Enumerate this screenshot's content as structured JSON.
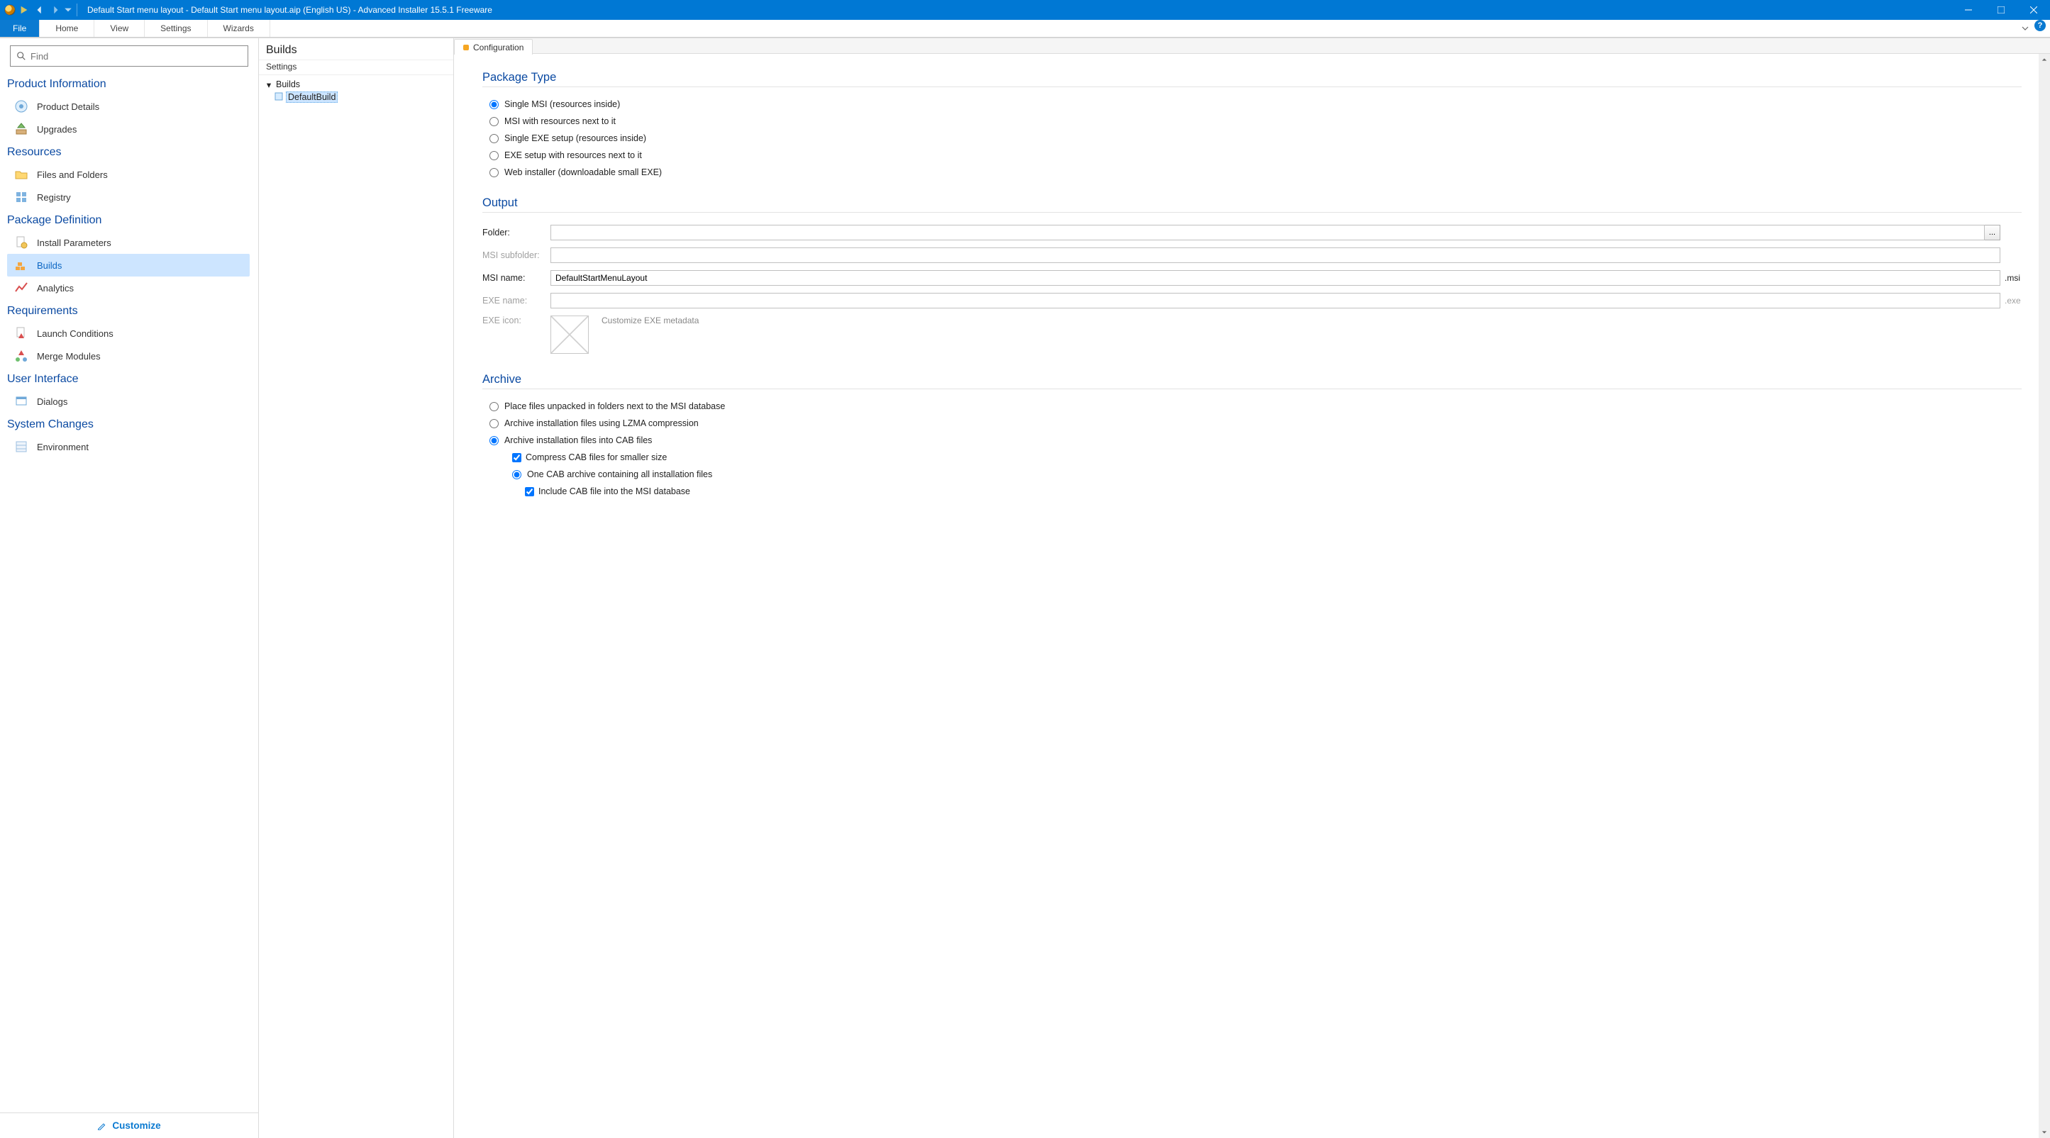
{
  "titlebar": {
    "text": "Default Start menu layout - Default Start menu layout.aip (English US) - Advanced Installer 15.5.1 Freeware"
  },
  "ribbon": {
    "file": "File",
    "tabs": [
      "Home",
      "View",
      "Settings",
      "Wizards"
    ]
  },
  "find": {
    "placeholder": "Find"
  },
  "nav": {
    "groups": [
      {
        "title": "Product Information",
        "items": [
          {
            "id": "product-details",
            "label": "Product Details"
          },
          {
            "id": "upgrades",
            "label": "Upgrades"
          }
        ]
      },
      {
        "title": "Resources",
        "items": [
          {
            "id": "files-and-folders",
            "label": "Files and Folders"
          },
          {
            "id": "registry",
            "label": "Registry"
          }
        ]
      },
      {
        "title": "Package Definition",
        "items": [
          {
            "id": "install-parameters",
            "label": "Install Parameters"
          },
          {
            "id": "builds",
            "label": "Builds",
            "active": true
          },
          {
            "id": "analytics",
            "label": "Analytics"
          }
        ]
      },
      {
        "title": "Requirements",
        "items": [
          {
            "id": "launch-conditions",
            "label": "Launch Conditions"
          },
          {
            "id": "merge-modules",
            "label": "Merge Modules"
          }
        ]
      },
      {
        "title": "User Interface",
        "items": [
          {
            "id": "dialogs",
            "label": "Dialogs"
          }
        ]
      },
      {
        "title": "System Changes",
        "items": [
          {
            "id": "environment",
            "label": "Environment"
          }
        ]
      }
    ],
    "customize": "Customize"
  },
  "tree": {
    "title": "Builds",
    "settings": "Settings",
    "root": "Builds",
    "item": "DefaultBuild"
  },
  "tabs": {
    "configuration": "Configuration"
  },
  "package_type": {
    "title": "Package Type",
    "options": [
      "Single MSI (resources inside)",
      "MSI with resources next to it",
      "Single EXE setup (resources inside)",
      "EXE setup with resources next to it",
      "Web installer (downloadable small EXE)"
    ],
    "selected": 0
  },
  "output": {
    "title": "Output",
    "folder_label": "Folder:",
    "folder_value": "",
    "browse": "...",
    "msi_subfolder_label": "MSI subfolder:",
    "msi_subfolder_value": "",
    "msi_name_label": "MSI name:",
    "msi_name_value": "DefaultStartMenuLayout",
    "msi_suffix": ".msi",
    "exe_name_label": "EXE name:",
    "exe_name_value": "",
    "exe_suffix": ".exe",
    "exe_icon_label": "EXE icon:",
    "exe_meta": "Customize EXE metadata"
  },
  "archive": {
    "title": "Archive",
    "options": [
      "Place files unpacked in folders next to the MSI database",
      "Archive installation files using LZMA compression",
      "Archive installation files into CAB files"
    ],
    "selected": 2,
    "compress": "Compress CAB files for smaller size",
    "compress_checked": true,
    "one_cab": "One CAB archive containing all installation files",
    "one_cab_selected": true,
    "include_cab": "Include CAB file into the MSI database",
    "include_cab_checked": true
  }
}
